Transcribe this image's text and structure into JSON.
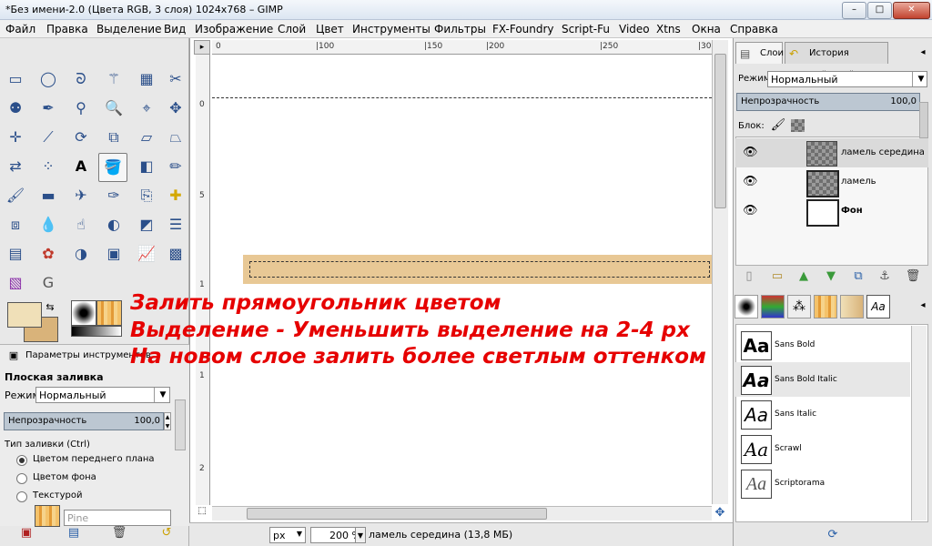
{
  "window": {
    "title": "*Без имени-2.0 (Цвета RGB, 3 слоя) 1024x768 – GIMP",
    "minimize": "–",
    "maximize": "□",
    "close": "✕"
  },
  "menu": [
    "Файл",
    "Правка",
    "Выделение",
    "Вид",
    "Изображение",
    "Слой",
    "Цвет",
    "Инструменты",
    "Фильтры",
    "FX-Foundry",
    "Script-Fu",
    "Video",
    "Xtns",
    "Окна",
    "Справка"
  ],
  "ruler": {
    "h": [
      "0",
      "|100",
      "|150",
      "|200",
      "|250",
      "|30"
    ],
    "v": [
      "0",
      "5",
      "1",
      "1",
      "2"
    ]
  },
  "tool_options": {
    "tab_label": "Параметры инструментов",
    "title": "Плоская заливка",
    "mode_label": "Режим:",
    "mode_value": "Нормальный",
    "opacity_label": "Непрозрачность",
    "opacity_value": "100,0",
    "fill_type_label": "Тип заливки  (Ctrl)",
    "fill_fg": "Цветом переднего плана",
    "fill_bg": "Цветом фона",
    "fill_pattern": "Текстурой",
    "pattern_name": "Pine"
  },
  "status": {
    "unit": "px",
    "zoom": "200 %",
    "info": "ламель середина (13,8 МБ)"
  },
  "layers_panel": {
    "tab_layers": "Слои",
    "tab_history": "История действий",
    "mode_label": "Режим:",
    "mode_value": "Нормальный",
    "opacity_label": "Непрозрачность",
    "opacity_value": "100,0",
    "lock_label": "Блок:",
    "layers": [
      "ламель середина",
      "ламель",
      "Фон"
    ]
  },
  "fonts_panel": {
    "fonts": [
      "Sans Bold",
      "Sans Bold Italic",
      "Sans Italic",
      "Scrawl",
      "Scriptorama"
    ],
    "preview": "Aa"
  },
  "overlay": [
    "Залить прямоугольник цветом",
    "Выделение - Уменьшить выделение на 2-4 px",
    "На новом слое залить более светлым оттенком"
  ],
  "colors": {
    "fg": "#f0e0b8",
    "bg": "#d9b37a",
    "plank": "#e8c895",
    "overlay": "#e60000"
  }
}
